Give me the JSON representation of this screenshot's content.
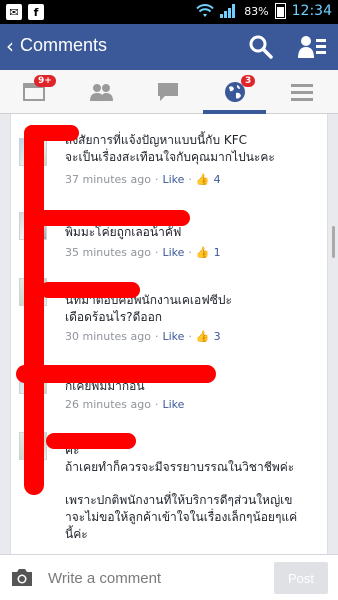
{
  "status_bar": {
    "battery": "83%",
    "time": "12:34"
  },
  "app_bar": {
    "back_glyph": "‹",
    "title": "Comments"
  },
  "tabs": [
    {
      "name": "news-feed",
      "badge": "9+"
    },
    {
      "name": "friend-requests",
      "badge": ""
    },
    {
      "name": "messages",
      "badge": ""
    },
    {
      "name": "notifications",
      "badge": "3"
    },
    {
      "name": "more",
      "badge": ""
    }
  ],
  "comments": [
    {
      "text_line1": "สงสัยการที่แจ้งปัญหาแบบนี้กับ KFC",
      "text_line2": "จะเป็นเรื่องสะเทือนใจกับคุณมากไปนะคะ",
      "time": "37 minutes ago",
      "like_label": "Like",
      "like_count": "4"
    },
    {
      "text_line1": "พิมมะโค่ยถูกเลอน้าคั๊ฟ",
      "time": "35 minutes ago",
      "like_label": "Like",
      "like_count": "1"
    },
    {
      "text_line1": "นี่ที่มาตอบคือพนักงานเคเอฟซีปะ",
      "text_line2": "เดือดร้อนไร?ดีออก",
      "time": "30 minutes ago",
      "like_label": "Like",
      "like_count": "3"
    },
    {
      "text_line1": "ก็เคยพิมมาก่อน",
      "time": "26 minutes ago",
      "like_label": "Like"
    },
    {
      "text_line1": "ค่ะ",
      "text_line2": "ถ้าเคยทำก็ควรจะมีจรรยาบรรณในวิชาชีพค่ะ",
      "text_line3": "เพราะปกติพนักงานที่ให้บริการดีๆส่วนใหญ่เข",
      "text_line4": "าจะไม่ขอให้ลูกค้าเข้าใจในเรื่องเล็กๆน้อยๆแค่",
      "text_line5": "นี้ค่ะ"
    }
  ],
  "composer": {
    "placeholder": "Write a comment",
    "post_label": "Post"
  },
  "colors": {
    "brand": "#3b5998",
    "redaction": "#ff0000",
    "badge": "#e0242a"
  }
}
